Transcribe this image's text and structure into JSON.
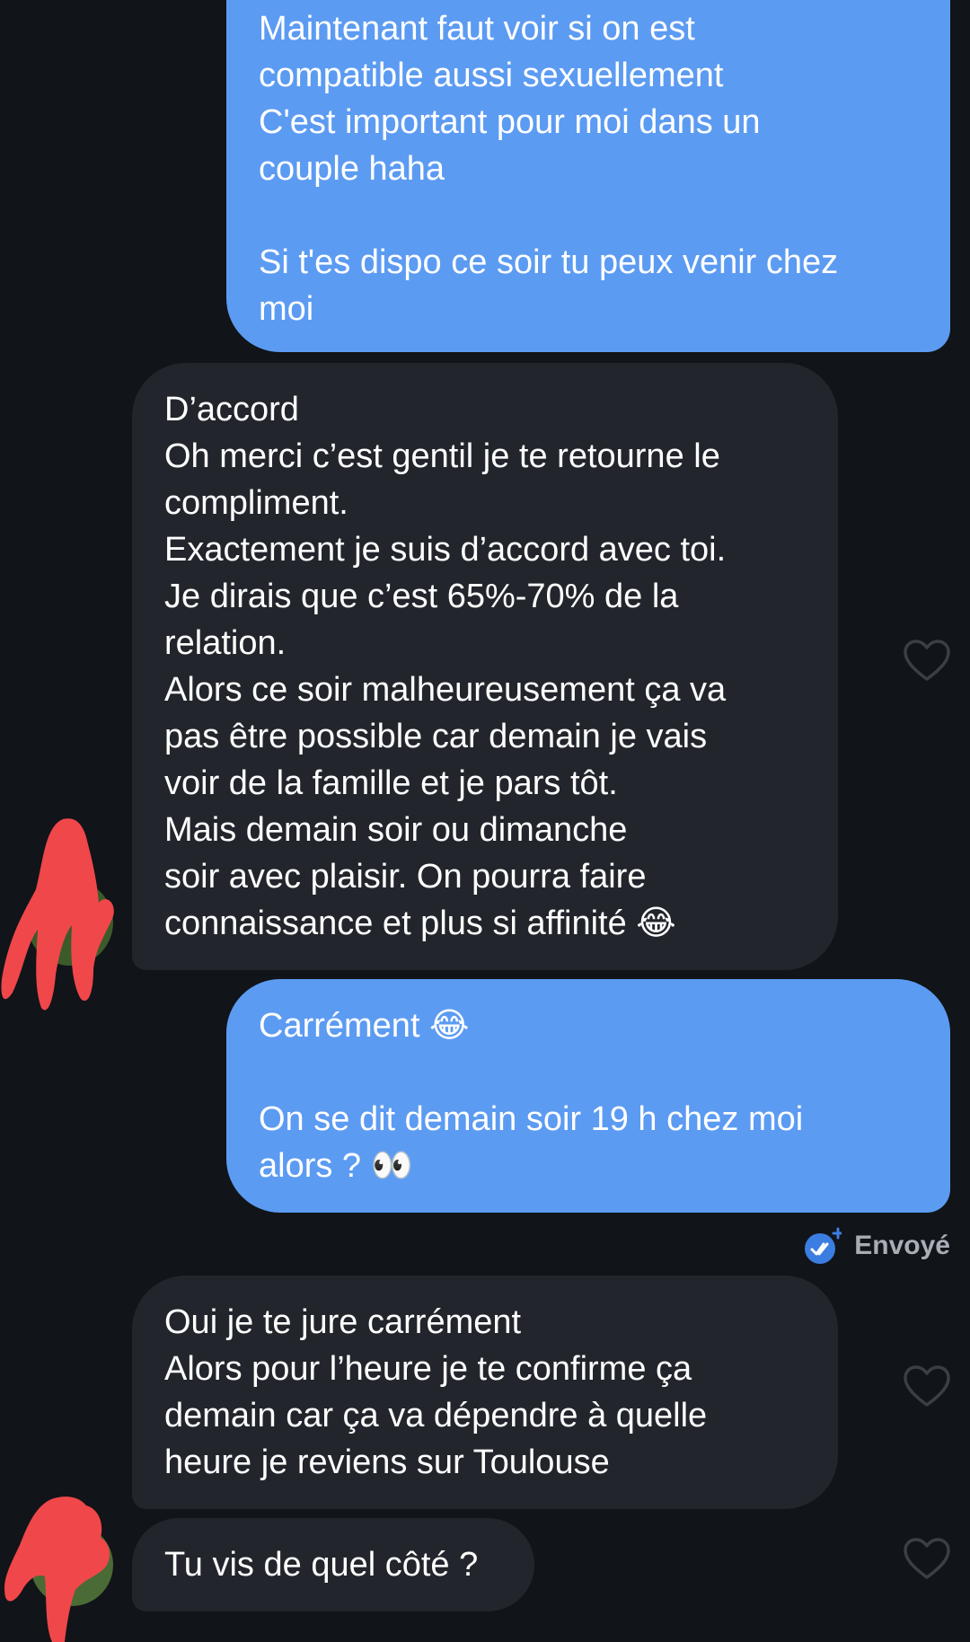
{
  "messages": [
    {
      "direction": "sent",
      "lines": [
        "Maintenant faut voir si on est",
        "compatible aussi sexuellement",
        "C'est important pour moi dans un",
        "couple haha",
        "",
        "Si t'es dispo ce soir tu peux venir chez",
        "moi"
      ]
    },
    {
      "direction": "received",
      "lines": [
        "D’accord",
        "Oh merci c’est gentil je te retourne le",
        "compliment.",
        "Exactement je suis d’accord avec toi.",
        "Je dirais que c’est 65%-70% de la",
        "relation.",
        "Alors ce soir malheureusement ça va",
        "pas être possible car demain je vais",
        "voir de la famille et je pars tôt.",
        "Mais demain soir ou dimanche",
        "soir avec plaisir. On pourra faire",
        "connaissance et plus si affinité 😂"
      ]
    },
    {
      "direction": "sent",
      "lines": [
        "Carrément 😂",
        "",
        "On se dit demain soir 19 h chez moi",
        "alors ? 👀"
      ]
    },
    {
      "direction": "received",
      "lines": [
        "Oui je te jure carrément",
        "Alors pour l’heure je te confirme ça",
        "demain car ça va dépendre à quelle",
        "heure je reviens sur Toulouse"
      ]
    },
    {
      "direction": "received",
      "lines": [
        "Tu vis de quel côté ?"
      ]
    }
  ],
  "status": {
    "text": "Envoyé",
    "icon": "double-check-icon"
  },
  "colors": {
    "background": "#111418",
    "sent_bubble": "#5c9bf2",
    "received_bubble": "#22262c",
    "text": "#ffffff",
    "status_text": "#a8adb6",
    "status_icon": "#3b7de0",
    "redaction": "#f0474b"
  }
}
